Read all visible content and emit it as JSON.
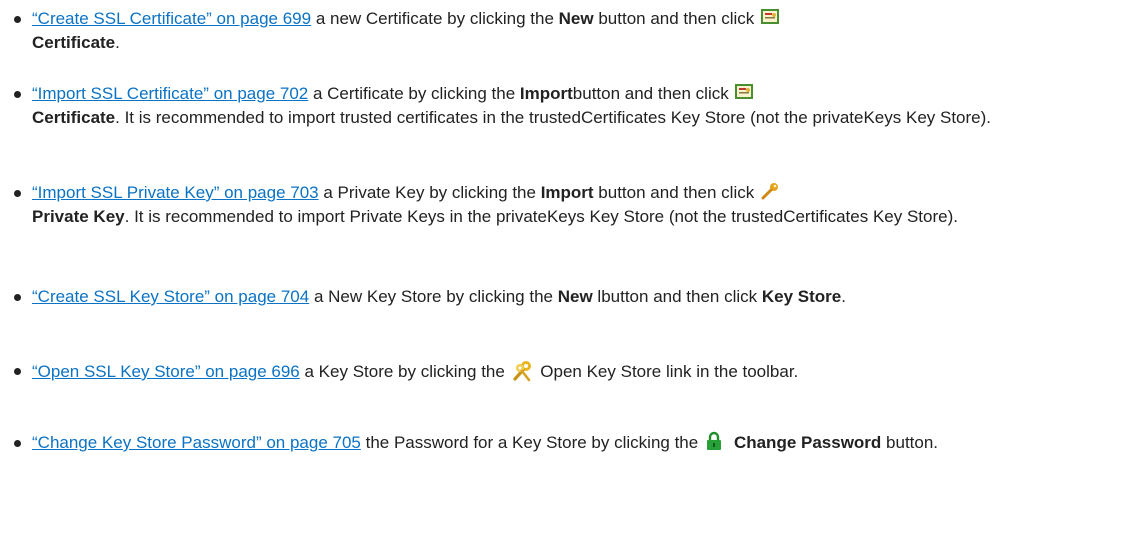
{
  "bullets": [
    {
      "link": "“Create SSL Certificate” on page 699",
      "t1": " a new Certificate by clicking the ",
      "b1": "New",
      "t2": " button and then click ",
      "icon": "certificate-icon",
      "b2": "Certificate",
      "t3": "."
    },
    {
      "link": "“Import SSL Certificate” on page 702",
      "t1": " a Certificate by clicking the ",
      "b1": "Import",
      "t2": "button and then click ",
      "icon": "certificate-icon",
      "b2": "Certificate",
      "t3": ". It is recommended to import trusted certificates in the trustedCertificates Key Store (not the privateKeys Key Store)."
    },
    {
      "link": "“Import SSL Private Key” on page 703",
      "t1": " a Private Key by clicking the ",
      "b1": "Import",
      "t2": " button and then click ",
      "icon": "key-icon",
      "b2": "Private Key",
      "t3": ". It is recommended to import Private Keys in the privateKeys Key Store (not the trustedCertificates Key Store)."
    },
    {
      "link": "“Create SSL Key Store” on page 704",
      "t1": " a New Key Store by clicking the ",
      "b1": "New",
      "t2": " lbutton and then click ",
      "b2": "Key Store",
      "t3": "."
    },
    {
      "link": "“Open SSL Key Store” on page 696",
      "t1": " a Key Store by clicking the ",
      "icon": "keys-icon",
      "t2": " Open Key Store link in the toolbar."
    },
    {
      "link": "“Change Key Store Password” on page 705",
      "t1": " the Password for a Key Store by clicking the ",
      "icon": "lock-icon",
      "b1": "Change Password",
      "t2": " button."
    }
  ]
}
